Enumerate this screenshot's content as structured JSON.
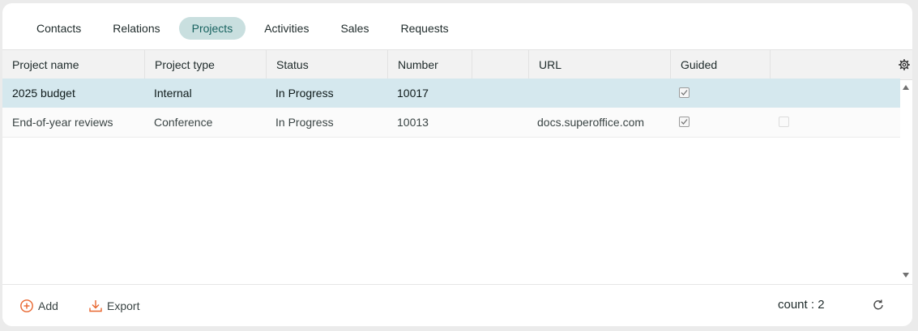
{
  "tabs": [
    {
      "label": "Contacts"
    },
    {
      "label": "Relations"
    },
    {
      "label": "Projects"
    },
    {
      "label": "Activities"
    },
    {
      "label": "Sales"
    },
    {
      "label": "Requests"
    }
  ],
  "active_tab": "Projects",
  "table": {
    "columns": [
      "Project name",
      "Project type",
      "Status",
      "Number",
      "",
      "URL",
      "Guided",
      ""
    ],
    "rows": [
      {
        "name": "2025 budget",
        "type": "Internal",
        "status": "In Progress",
        "number": "10017",
        "url": "",
        "guided": true,
        "selected": true
      },
      {
        "name": "End-of-year reviews",
        "type": "Conference",
        "status": "In Progress",
        "number": "10013",
        "url": "docs.superoffice.com",
        "guided": true,
        "extra_checked": false,
        "selected": false
      }
    ]
  },
  "footer": {
    "add_label": "Add",
    "export_label": "Export",
    "count_text": "count : 2"
  },
  "icons": {
    "settings": "gear-icon",
    "add": "plus-circle-icon",
    "export": "download-icon",
    "refresh": "refresh-icon"
  },
  "colors": {
    "active_tab_bg": "#c9dfdf",
    "active_tab_text": "#17625f",
    "selected_row_bg": "#d5e8ee",
    "accent_orange": "#e8662f"
  }
}
